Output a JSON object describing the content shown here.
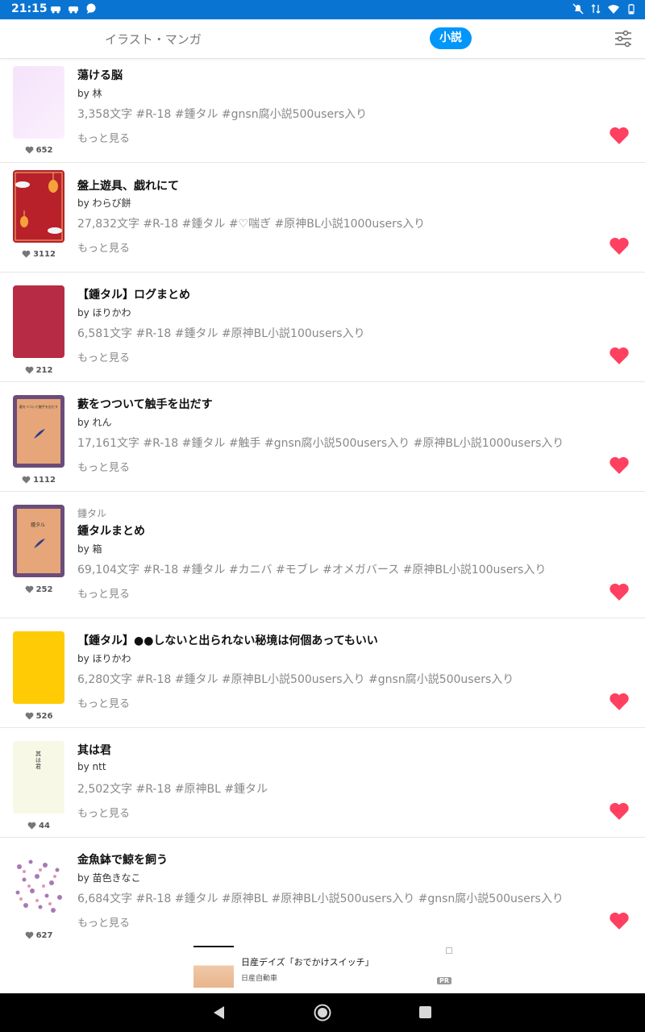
{
  "status_bar": {
    "time": "21:15"
  },
  "tabs": {
    "illust_manga": "イラスト・マンガ",
    "novel": "小説"
  },
  "colors": {
    "accent": "#0096fa",
    "heart": "#ff4060",
    "status_bar": "#0a74d3"
  },
  "novels": [
    {
      "series": "",
      "title": "蕩ける脳",
      "author": "by 林",
      "meta": "3,358文字  #R-18  #鍾タル  #gnsn腐小説500users入り",
      "more": "もっと見る",
      "likes": "652"
    },
    {
      "series": "",
      "title": "盤上遊具、戯れにて",
      "author": "by わらび餅",
      "meta": "27,832文字  #R-18  #鍾タル  #♡喘ぎ  #原神BL小説1000users入り",
      "more": "もっと見る",
      "likes": "3112"
    },
    {
      "series": "",
      "title": "【鍾タル】ログまとめ",
      "author": "by ほりかわ",
      "meta": "6,581文字  #R-18  #鍾タル  #原神BL小説100users入り",
      "more": "もっと見る",
      "likes": "212"
    },
    {
      "series": "",
      "title": "藪をつついて触手を出だす",
      "author": "by れん",
      "meta": "17,161文字  #R-18  #鍾タル  #触手  #gnsn腐小説500users入り  #原神BL小説1000users入り",
      "more": "もっと見る",
      "likes": "1112"
    },
    {
      "series": "鍾タル",
      "title": "鍾タルまとめ",
      "author": "by 箱",
      "meta": "69,104文字  #R-18  #鍾タル  #カニバ  #モブレ  #オメガバース  #原神BL小説100users入り",
      "more": "もっと見る",
      "likes": "252"
    },
    {
      "series": "",
      "title": "【鍾タル】●●しないと出られない秘境は何個あってもいい",
      "author": "by ほりかわ",
      "meta": "6,280文字  #R-18  #鍾タル  #原神BL小説500users入り  #gnsn腐小説500users入り",
      "more": "もっと見る",
      "likes": "526"
    },
    {
      "series": "",
      "title": "其は君",
      "author": "by ntt",
      "meta": "2,502文字  #R-18  #原神BL  #鍾タル",
      "more": "もっと見る",
      "likes": "44"
    },
    {
      "series": "",
      "title": "金魚鉢で鯨を飼う",
      "author": "by 苗色きなこ",
      "meta": "6,684文字  #R-18  #鍾タル  #原神BL  #原神BL小説500users入り  #gnsn腐小説500users入り",
      "more": "もっと見る",
      "likes": "627"
    }
  ],
  "covers": {
    "c2_text": "其は君",
    "c4_text": "藪をつついて触手を出だす",
    "c5_text": "鍾タル"
  },
  "ad": {
    "title": "日産デイズ「おでかけスイッチ」",
    "advertiser": "日産自動車",
    "pr": "PR"
  }
}
